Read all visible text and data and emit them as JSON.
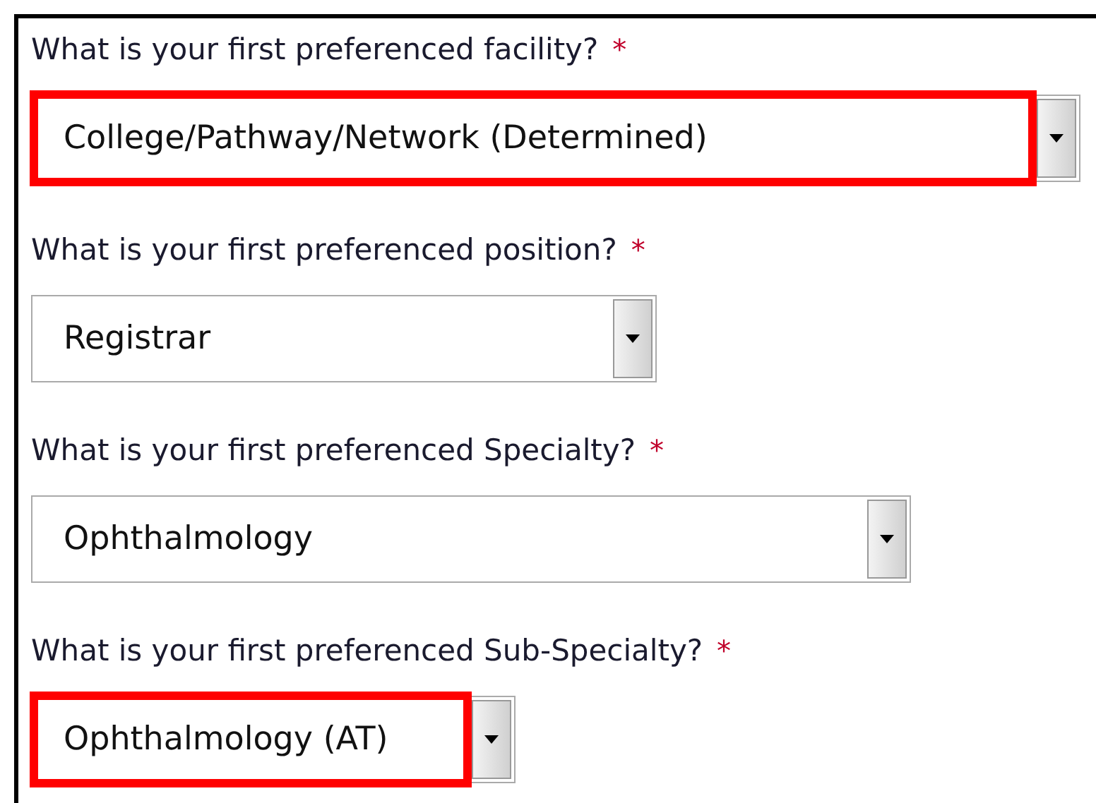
{
  "fields": [
    {
      "label": "What is your first preferenced facility?",
      "required_mark": "*",
      "value": "College/Pathway/Network (Determined)",
      "highlighted": true
    },
    {
      "label": "What is your first preferenced position?",
      "required_mark": "*",
      "value": "Registrar",
      "highlighted": false
    },
    {
      "label": "What is your first preferenced Specialty?",
      "required_mark": "*",
      "value": "Ophthalmology",
      "highlighted": false
    },
    {
      "label": "What is your first preferenced Sub-Specialty?",
      "required_mark": "*",
      "value": "Ophthalmology (AT)",
      "highlighted": true
    }
  ]
}
